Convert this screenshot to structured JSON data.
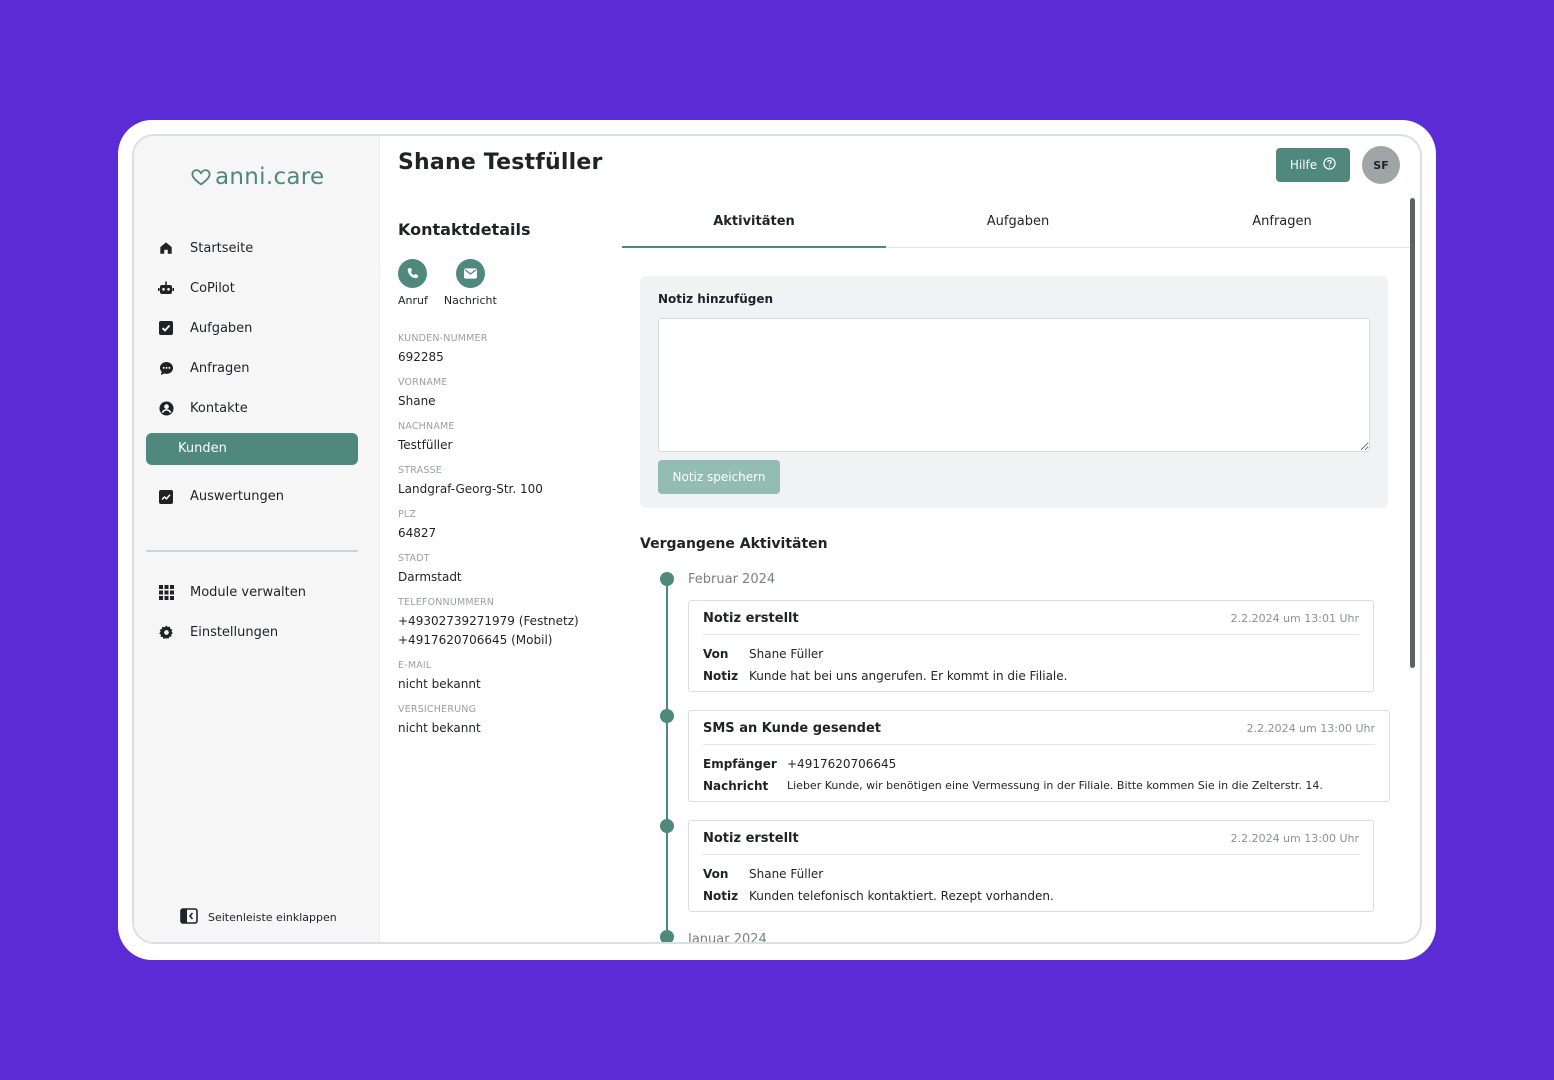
{
  "app": {
    "logo_text": "anni.care"
  },
  "sidebar": {
    "items": [
      {
        "label": "Startseite",
        "icon": "home-icon"
      },
      {
        "label": "CoPilot",
        "icon": "robot-icon"
      },
      {
        "label": "Aufgaben",
        "icon": "checkbox-icon"
      },
      {
        "label": "Anfragen",
        "icon": "chat-icon"
      },
      {
        "label": "Kontakte",
        "icon": "user-circle-icon"
      },
      {
        "label": "Kunden",
        "icon": "",
        "active": true
      },
      {
        "label": "Auswertungen",
        "icon": "chart-icon"
      }
    ],
    "secondary_items": [
      {
        "label": "Module verwalten",
        "icon": "grid-icon"
      },
      {
        "label": "Einstellungen",
        "icon": "gear-icon"
      }
    ],
    "collapse_label": "Seitenleiste einklappen"
  },
  "header": {
    "title": "Shane Testfüller",
    "help_label": "Hilfe",
    "avatar_initials": "SF"
  },
  "contact": {
    "heading": "Kontaktdetails",
    "call_label": "Anruf",
    "message_label": "Nachricht",
    "fields": [
      {
        "label": "KUNDEN-NUMMER",
        "value": "692285"
      },
      {
        "label": "VORNAME",
        "value": "Shane"
      },
      {
        "label": "NACHNAME",
        "value": "Testfüller"
      },
      {
        "label": "STRAßE",
        "value": "Landgraf-Georg-Str. 100"
      },
      {
        "label": "PLZ",
        "value": "64827"
      },
      {
        "label": "STADT",
        "value": "Darmstadt"
      },
      {
        "label": "TELEFONNUMMERN",
        "value": "+49302739271979 (Festnetz)",
        "value2": "+4917620706645 (Mobil)"
      },
      {
        "label": "E-MAIL",
        "value": "nicht bekannt"
      },
      {
        "label": "VERSICHERUNG",
        "value": "nicht bekannt"
      }
    ]
  },
  "tabs": [
    {
      "label": "Aktivitäten",
      "active": true
    },
    {
      "label": "Aufgaben"
    },
    {
      "label": "Anfragen"
    }
  ],
  "note": {
    "label": "Notiz hinzufügen",
    "value": "",
    "save_label": "Notiz speichern"
  },
  "activities": {
    "heading": "Vergangene Aktivitäten",
    "months": [
      "Februar 2024",
      "Januar 2024"
    ],
    "items": [
      {
        "title": "Notiz erstellt",
        "time": "2.2.2024 um 13:01 Uhr",
        "rows": [
          {
            "key": "Von",
            "value": "Shane Füller"
          },
          {
            "key": "Notiz",
            "value": "Kunde hat bei uns angerufen. Er kommt in die Filiale."
          }
        ]
      },
      {
        "title": "SMS an Kunde gesendet",
        "time": "2.2.2024 um 13:00 Uhr",
        "rows": [
          {
            "key": "Empfänger",
            "value": "+4917620706645"
          },
          {
            "key": "Nachricht",
            "value": "Lieber Kunde, wir benötigen eine Vermessung in der Filiale. Bitte kommen Sie in die Zelterstr. 14."
          }
        ]
      },
      {
        "title": "Notiz erstellt",
        "time": "2.2.2024 um 13:00 Uhr",
        "rows": [
          {
            "key": "Von",
            "value": "Shane Füller"
          },
          {
            "key": "Notiz",
            "value": "Kunden telefonisch kontaktiert. Rezept vorhanden."
          }
        ]
      }
    ]
  },
  "colors": {
    "accent": "#4f887c",
    "background": "#5b2bd6",
    "button_disabled": "#93bcb3"
  }
}
